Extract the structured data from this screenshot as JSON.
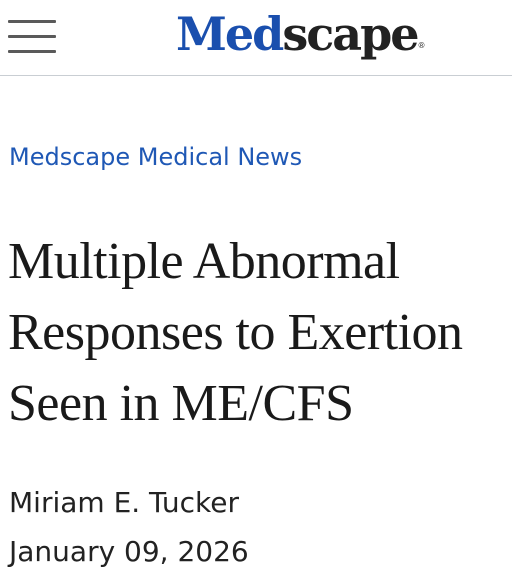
{
  "header": {
    "menu_icon": "hamburger-menu-icon",
    "logo": {
      "part1": "Med",
      "part2": "scape",
      "registered": "®"
    },
    "colors": {
      "logo_blue": "#1a4fae",
      "logo_dark": "#222222",
      "link_blue": "#1f58b5"
    }
  },
  "article": {
    "section": "Medscape Medical News",
    "title_lines": [
      "Multiple Abnormal",
      "Responses to Exertion",
      "Seen in ME/CFS"
    ],
    "author": "Miriam E. Tucker",
    "date": "January 09, 2026"
  }
}
